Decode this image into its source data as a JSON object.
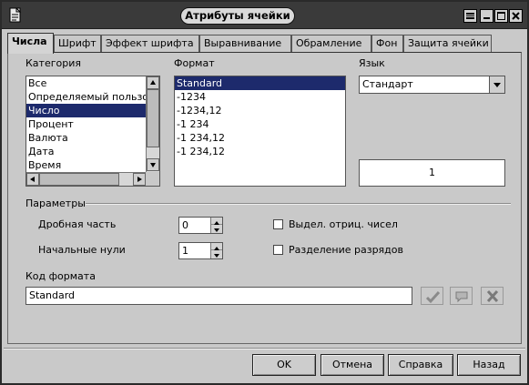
{
  "window": {
    "title": "Атрибуты ячейки"
  },
  "tabs": [
    {
      "label": "Числа",
      "active": true
    },
    {
      "label": "Шрифт"
    },
    {
      "label": "Эффект шрифта"
    },
    {
      "label": "Выравнивание"
    },
    {
      "label": "Обрамление"
    },
    {
      "label": "Фон"
    },
    {
      "label": "Защита ячейки"
    }
  ],
  "category": {
    "label": "Категория",
    "items": [
      "Все",
      "Определяемый пользо",
      "Число",
      "Процент",
      "Валюта",
      "Дата",
      "Время"
    ],
    "selected": "Число"
  },
  "format": {
    "label": "Формат",
    "items": [
      "Standard",
      "-1234",
      "-1234,12",
      "-1 234",
      "-1 234,12",
      "-1 234,12"
    ],
    "selected": "Standard"
  },
  "language": {
    "label": "Язык",
    "value": "Стандарт"
  },
  "preview": {
    "value": "1"
  },
  "options": {
    "label": "Параметры",
    "decimal_label": "Дробная часть",
    "decimal_value": "0",
    "leading_zeros_label": "Начальные нули",
    "leading_zeros_value": "1",
    "negative_red_label": "Выдел. отриц. чисел",
    "thousands_sep_label": "Разделение разрядов"
  },
  "format_code": {
    "label": "Код формата",
    "value": "Standard"
  },
  "buttons": {
    "ok": "OK",
    "cancel": "Отмена",
    "help": "Справка",
    "back": "Назад"
  },
  "colors": {
    "selection": "#1d2a6c",
    "titlebar": "#3a3a3a",
    "dialog_bg": "#c9c9c9"
  }
}
